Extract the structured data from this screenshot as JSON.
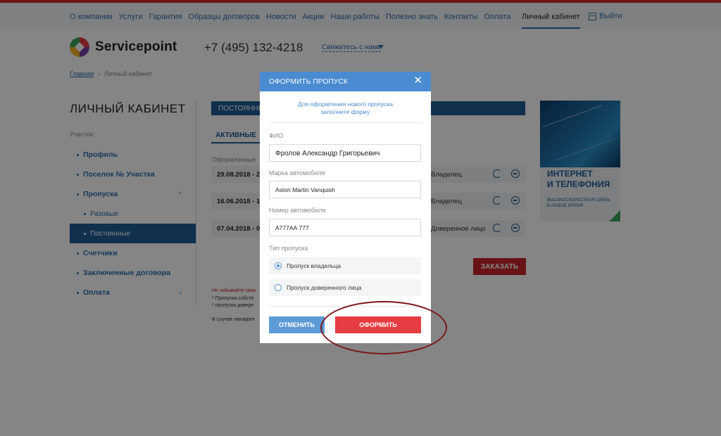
{
  "nav": {
    "items": [
      "О компании",
      "Услуги",
      "Гарантия",
      "Образцы договоров",
      "Новости",
      "Акции",
      "Наши работы",
      "Полезно знать",
      "Контакты",
      "Оплата"
    ],
    "cabinet": "Личный кабинет",
    "logout": "Выйти"
  },
  "header": {
    "logo": "Servicepoint",
    "phone": "+7 (495) 132-4218",
    "contact": "Свяжитесь с нами"
  },
  "breadcrumb": {
    "home": "Главная",
    "current": "Личный кабинет"
  },
  "cabinet": {
    "title": "ЛИЧНЫЙ КАБИНЕТ",
    "plot_label": "Участок:",
    "menu": {
      "profile": "Профиль",
      "settlement": "Поселок № Участка",
      "passes": "Пропуска",
      "one_time": "Разовые",
      "permanent": "Постоянные",
      "meters": "Счетчики",
      "contracts": "Заключенные договора",
      "payment": "Оплата"
    }
  },
  "content": {
    "section_title": "ПОСТОЯННЫ",
    "tab_active": "АКТИВНЫЕ",
    "issued_label": "Оформленные",
    "rows": [
      {
        "date": "29.08.2018 - 2",
        "role": "Владелец"
      },
      {
        "date": "16.06.2018 - 1",
        "role": "Владелец"
      },
      {
        "date": "07.04.2018 - 0",
        "role": "Доверенное лицо"
      }
    ],
    "order_button": "ЗАКАЗАТЬ",
    "note_red": "Не забывайте свое",
    "note1": "* Пропуска собств",
    "note2": "* пропуска довере",
    "note3": "В случае некоррек"
  },
  "banner": {
    "title_line1": "ИНТЕРНЕТ",
    "title_line2": "И ТЕЛЕФОНИЯ",
    "sub": "ВЫСОКОСКОРОСТНАЯ СВЯЗЬ В ЛЮБОЕ ВРЕМЯ"
  },
  "modal": {
    "title": "ОФОРМИТЬ ПРОПУСК",
    "close": "✕",
    "intro_line1": "Для оформления нового пропуска",
    "intro_line2": "заполните форму",
    "fio_label": "ФИО",
    "fio_value": "Фролов Александр Григорьевич",
    "car_label": "Марка автомобиля",
    "car_value": "Aston Martin Vanquish",
    "number_label": "Номер автомобиля",
    "number_value": "А777АА 777",
    "type_label": "Тип пропуска",
    "type_owner": "Пропуск владельца",
    "type_trusted": "Пропуск доверенного лица",
    "selected_type": "owner",
    "cancel": "ОТМЕНИТЬ",
    "submit": "ОФОРМИТЬ"
  },
  "colors": {
    "accent_blue": "#4a8bd2",
    "dark_blue": "#1f5d96",
    "submit_red": "#e63d42",
    "highlight": "#7a1717"
  }
}
